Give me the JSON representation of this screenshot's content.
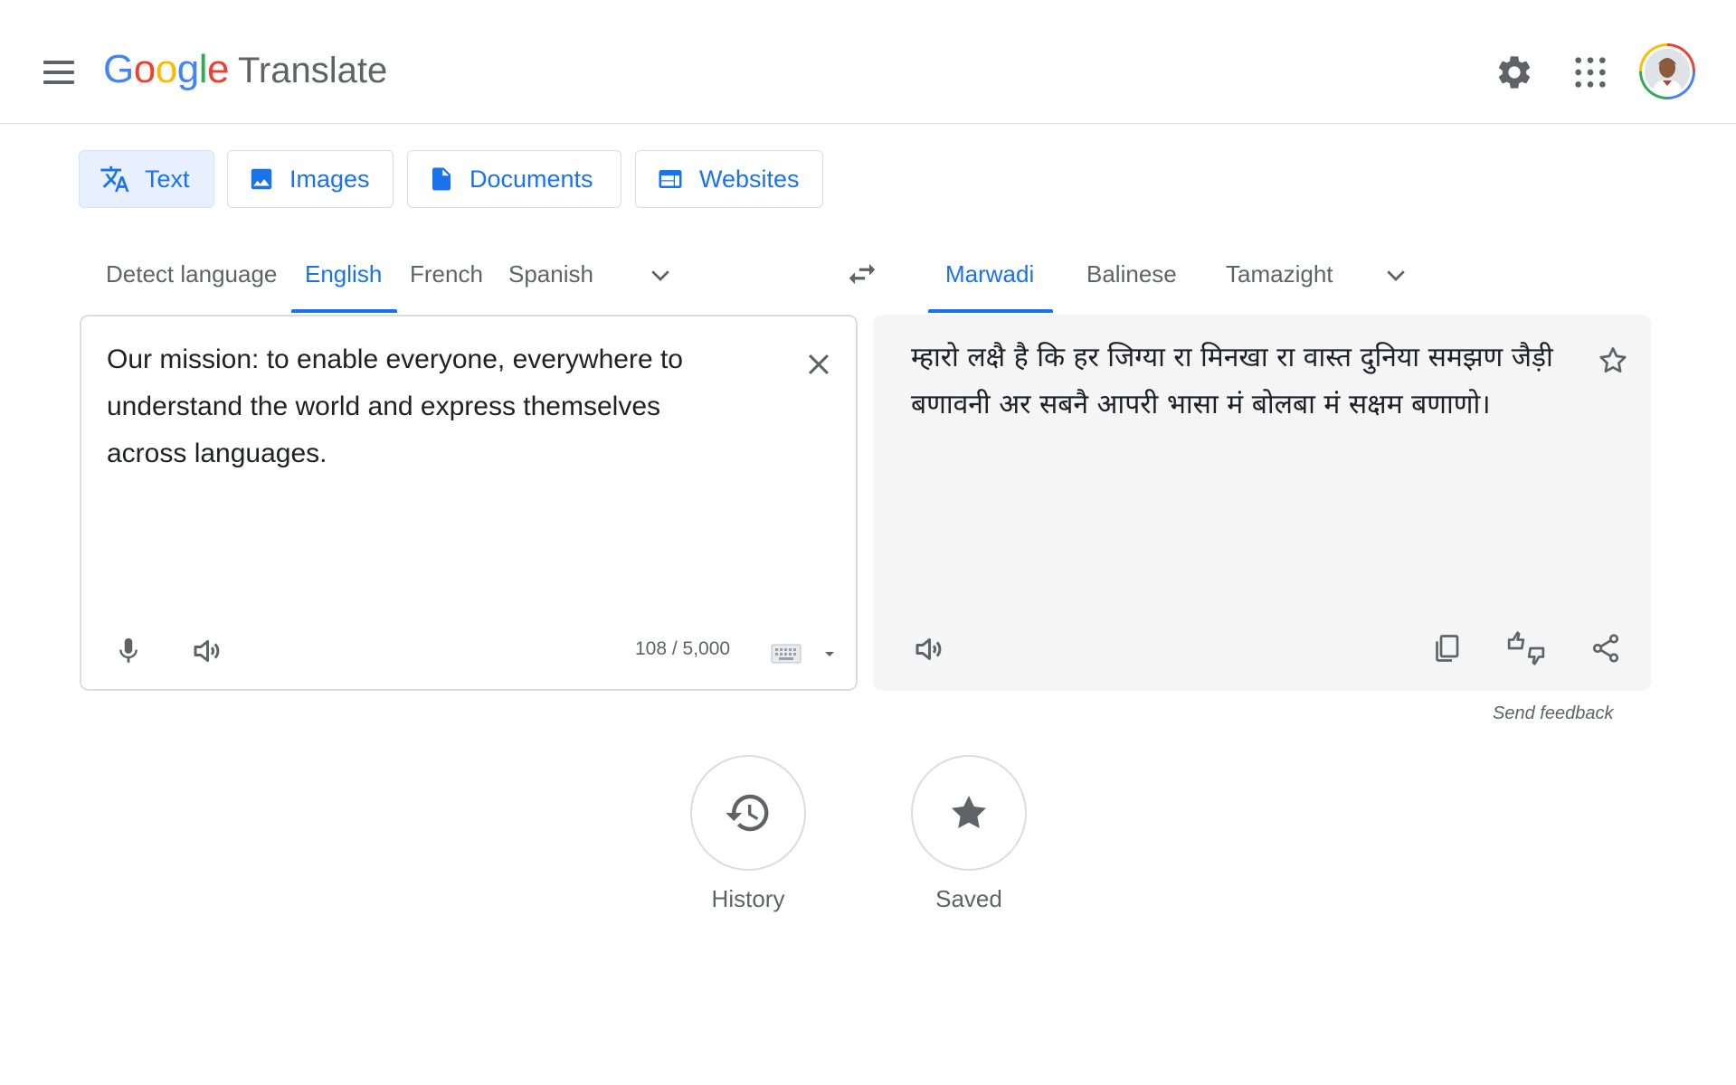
{
  "header": {
    "logo_letters": [
      {
        "ch": "G",
        "color": "#4285f4"
      },
      {
        "ch": "o",
        "color": "#ea4335"
      },
      {
        "ch": "o",
        "color": "#fbbc05"
      },
      {
        "ch": "g",
        "color": "#4285f4"
      },
      {
        "ch": "l",
        "color": "#34a853"
      },
      {
        "ch": "e",
        "color": "#ea4335"
      }
    ],
    "product": "Translate",
    "icons": [
      "menu-icon",
      "gear-icon",
      "apps-grid-icon",
      "avatar"
    ]
  },
  "modes": [
    {
      "label": "Text",
      "icon": "translate-icon",
      "active": true
    },
    {
      "label": "Images",
      "icon": "image-icon",
      "active": false
    },
    {
      "label": "Documents",
      "icon": "document-icon",
      "active": false
    },
    {
      "label": "Websites",
      "icon": "website-icon",
      "active": false
    }
  ],
  "source_langs": {
    "detect": "Detect language",
    "items": [
      "English",
      "French",
      "Spanish"
    ],
    "selected": "English"
  },
  "target_langs": {
    "items": [
      "Marwadi",
      "Balinese",
      "Tamazight"
    ],
    "selected": "Marwadi"
  },
  "source": {
    "text": "Our mission: to enable everyone, everywhere to understand the world and express themselves across languages.",
    "char_count": "108 / 5,000"
  },
  "target": {
    "text": "म्हारो लक्षै है कि हर जिग्या रा मिनखा रा वास्त दुनिया समझण जैड़ी बणावनी अर सबनै आपरी भासा मं बोलबा मं सक्षम बणाणो।"
  },
  "feedback": "Send feedback",
  "bottom": {
    "history": "History",
    "saved": "Saved"
  },
  "colors": {
    "accent": "#1a73e8",
    "active_tab_bg": "#e8f0fe",
    "target_panel_bg": "#f5f5f5",
    "icon_gray": "#5f6368"
  }
}
